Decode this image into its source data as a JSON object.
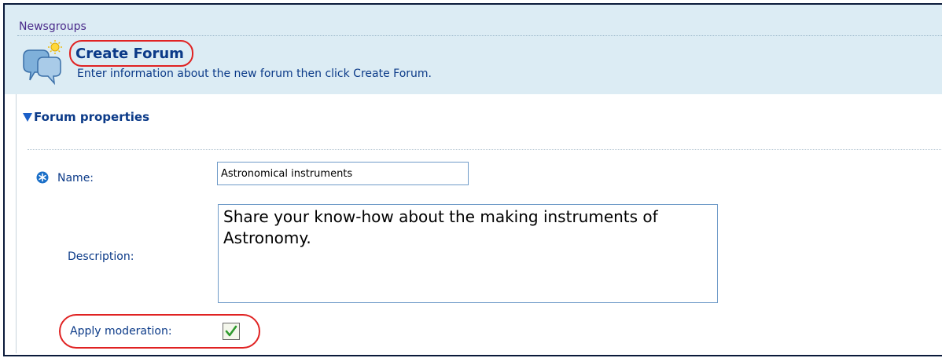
{
  "breadcrumb": "Newsgroups",
  "page": {
    "title": "Create Forum",
    "subtitle": "Enter information about the new forum then click Create Forum.",
    "icon": "newsgroup-chat-bubbles-icon"
  },
  "section": {
    "title": "Forum properties",
    "toggle_icon": "collapse-triangle-icon"
  },
  "form": {
    "name": {
      "label": "Name:",
      "value": "Astronomical instruments",
      "required_icon": "required-field-icon"
    },
    "description": {
      "label": "Description:",
      "value": "Share your know-how about the making instruments of Astronomy."
    },
    "moderation": {
      "label": "Apply moderation:",
      "checked": true
    }
  },
  "colors": {
    "header_bg": "#dcecf4",
    "title": "#0b3a88",
    "highlight": "#e02222",
    "check": "#2e9a2e"
  }
}
